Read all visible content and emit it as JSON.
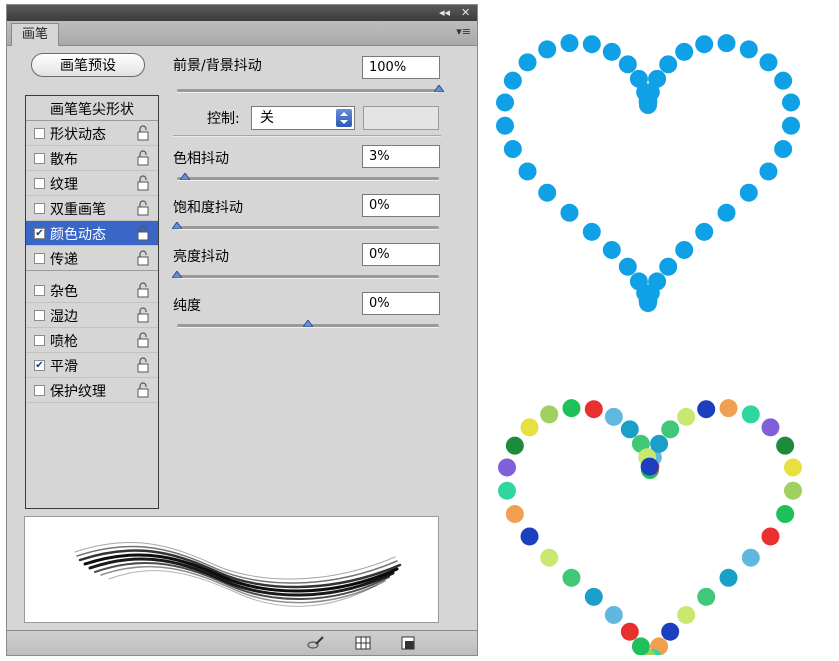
{
  "titlebar": {
    "collapse_glyph": "◂◂",
    "close_glyph": "✕"
  },
  "panel": {
    "tab_label": "画笔",
    "menu_glyph": "▾≡"
  },
  "preset_button_label": "画笔预设",
  "brush_list": {
    "header": "画笔笔尖形状",
    "items": [
      {
        "label": "形状动态",
        "checked": false,
        "selected": false
      },
      {
        "label": "散布",
        "checked": false,
        "selected": false
      },
      {
        "label": "纹理",
        "checked": false,
        "selected": false
      },
      {
        "label": "双重画笔",
        "checked": false,
        "selected": false
      },
      {
        "label": "颜色动态",
        "checked": true,
        "selected": true
      },
      {
        "label": "传递",
        "checked": false,
        "selected": false
      },
      {
        "label": "杂色",
        "checked": false,
        "selected": false
      },
      {
        "label": "湿边",
        "checked": false,
        "selected": false
      },
      {
        "label": "喷枪",
        "checked": false,
        "selected": false
      },
      {
        "label": "平滑",
        "checked": true,
        "selected": false
      },
      {
        "label": "保护纹理",
        "checked": false,
        "selected": false
      }
    ]
  },
  "settings": {
    "fg_bg_jitter": {
      "label": "前景/背景抖动",
      "value": "100%",
      "level": 1.0
    },
    "control": {
      "label": "控制:",
      "value": "关"
    },
    "hue_jitter": {
      "label": "色相抖动",
      "value": "3%",
      "level": 0.03
    },
    "saturation_jitter": {
      "label": "饱和度抖动",
      "value": "0%",
      "level": 0.0
    },
    "brightness_jitter": {
      "label": "亮度抖动",
      "value": "0%",
      "level": 0.0
    },
    "purity": {
      "label": "纯度",
      "value": "0%",
      "level": 0.5
    }
  },
  "colors": {
    "selected_row": "#3a66c8",
    "heart_top": "#0fa0e6",
    "heart_bottom": [
      "#1fc05a",
      "#2fd6a0",
      "#1aa0c8",
      "#e6e040",
      "#1b3fbf",
      "#e83030",
      "#8060d8",
      "#40c878",
      "#a0d060",
      "#f0a050",
      "#60b8e0",
      "#1e8a3c",
      "#c8e870"
    ]
  },
  "icons": [
    "collapse-icon",
    "close-icon",
    "panel-menu-icon",
    "lock-icon",
    "create-brush-icon",
    "grid-icon",
    "new-preset-icon"
  ]
}
